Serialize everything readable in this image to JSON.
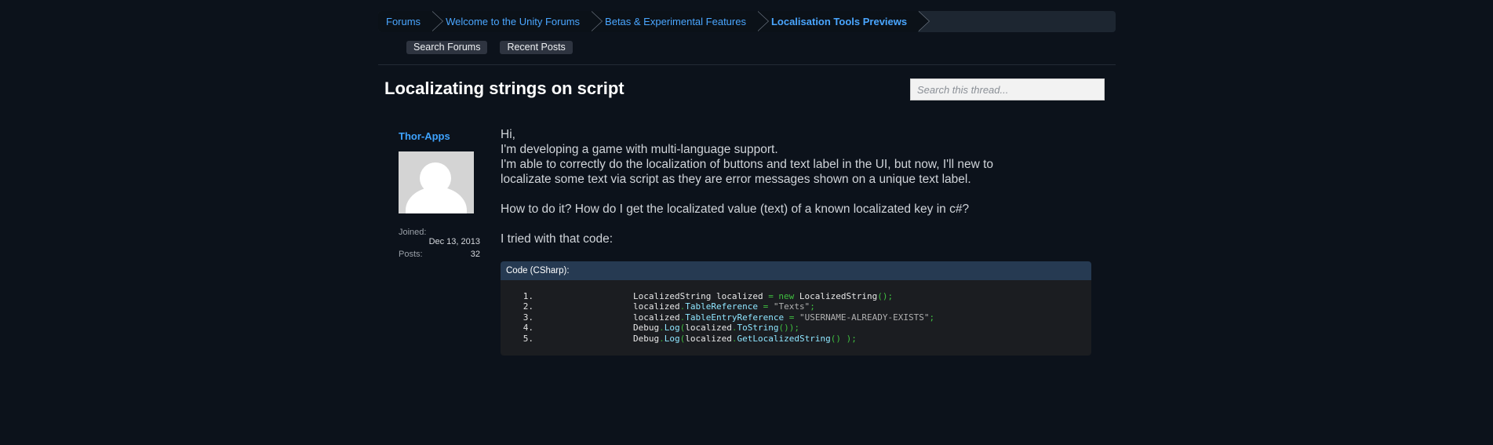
{
  "breadcrumb": [
    {
      "label": "Forums"
    },
    {
      "label": "Welcome to the Unity Forums"
    },
    {
      "label": "Betas & Experimental Features"
    },
    {
      "label": "Localisation Tools Previews"
    }
  ],
  "subnav": {
    "search_forums": "Search Forums",
    "recent_posts": "Recent Posts"
  },
  "thread": {
    "title": "Localizating strings on script",
    "search_placeholder": "Search this thread..."
  },
  "author": {
    "name": "Thor-Apps",
    "joined_label": "Joined:",
    "joined_value": "Dec 13, 2013",
    "posts_label": "Posts:",
    "posts_value": "32"
  },
  "post": {
    "line1": "Hi,",
    "line2": "I'm developing a game with multi-language support.",
    "line3": "I'm able to correctly do the localization of buttons and text label in the UI, but now, I'll new to localizate some text via script as they are error messages shown on a unique text label.",
    "line4": "How to do it? How do I get the localizated value (text) of a known localizated key in c#?",
    "line5": "I tried with that code:"
  },
  "code": {
    "header": "Code (CSharp):",
    "line_numbers": [
      "1.",
      "2.",
      "3.",
      "4.",
      "5."
    ],
    "l1": {
      "a": "LocalizedString localized ",
      "op": "=",
      "kw": " new",
      "b": " LocalizedString",
      "c": "();"
    },
    "l2": {
      "a": "localized",
      "d": ".",
      "m": "TableReference",
      "op": " =",
      "s": " \"Texts\"",
      "e": ";"
    },
    "l3": {
      "a": "localized",
      "d": ".",
      "m": "TableEntryReference",
      "op": " =",
      "s": " \"USERNAME-ALREADY-EXISTS\"",
      "e": ";"
    },
    "l4": {
      "a": "Debug",
      "d": ".",
      "m": "Log",
      "p1": "(",
      "b": "localized",
      "d2": ".",
      "m2": "ToString",
      "p2": "());"
    },
    "l5": {
      "a": "Debug",
      "d": ".",
      "m": "Log",
      "p1": "(",
      "b": "localized",
      "d2": ".",
      "m2": "GetLocalizedString",
      "p2": "() );"
    }
  }
}
